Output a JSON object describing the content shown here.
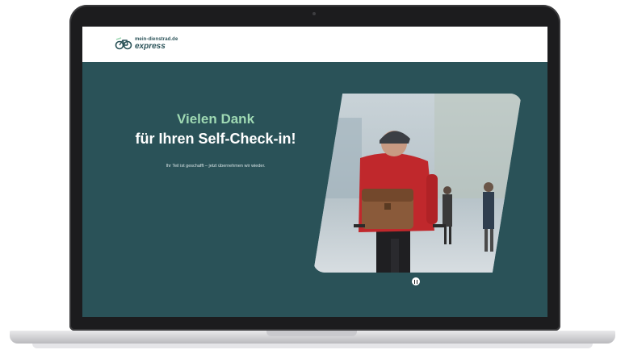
{
  "logo": {
    "line1": "mein-dienstrad.de",
    "line2": "express",
    "icon": "bike-icon"
  },
  "hero": {
    "heading_line1": "Vielen Dank",
    "heading_line2": "für Ihren Self-Check-in!",
    "subtext": "Ihr Teil ist geschafft – jetzt übernehmen wir wieder."
  },
  "media": {
    "control_icon": "pause-icon"
  },
  "colors": {
    "background": "#2a5258",
    "accent": "#9fd9b3",
    "header": "#ffffff"
  }
}
